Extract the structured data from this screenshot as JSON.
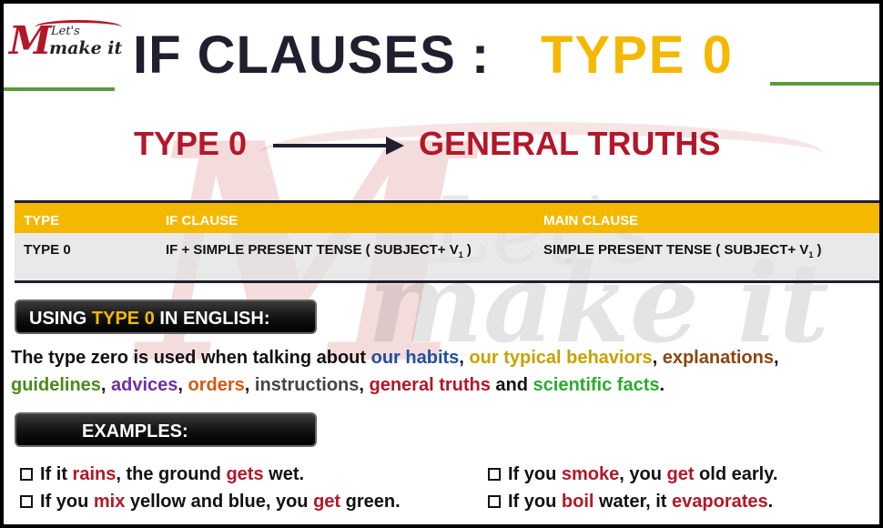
{
  "logo": {
    "m": "M",
    "lets": "Let's",
    "make": "make it"
  },
  "watermark": {
    "m": "M",
    "lets": "Let's",
    "make": "make it"
  },
  "header": {
    "title": "IF CLAUSES :",
    "type": "TYPE  0"
  },
  "subheading": {
    "left": "TYPE 0",
    "right": "GENERAL TRUTHS"
  },
  "table": {
    "columns": [
      "TYPE",
      "IF CLAUSE",
      "MAIN CLAUSE"
    ],
    "row": {
      "type": "TYPE 0",
      "if_clause": "IF + SIMPLE PRESENT TENSE ( SUBJECT+ V",
      "if_clause_sub": "1",
      "if_clause_end": " )",
      "main_clause": "SIMPLE PRESENT TENSE ( SUBJECT+ V",
      "main_clause_sub": "1",
      "main_clause_end": " )"
    }
  },
  "using_section": {
    "prefix": "USING ",
    "highlight": "TYPE 0",
    "suffix": "  IN ENGLISH:"
  },
  "paragraph": {
    "p1": "The type zero is used when talking about ",
    "k1": "our habits",
    "s1": ", ",
    "k2": "our typical behaviors",
    "s2": ", ",
    "k3": "explanations",
    "s3": ", ",
    "k4": "guidelines",
    "s4": ", ",
    "k5": "advices",
    "s5": ", ",
    "k6": "orders",
    "s6": ", ",
    "k7": "instructions",
    "s7": ", ",
    "k8": "general truths",
    "s8": " and ",
    "k9": "scientific facts",
    "s9": "."
  },
  "examples_section": {
    "label": "EXAMPLES:"
  },
  "examples": [
    {
      "a": "If it ",
      "b": "rains",
      "c": ", the ground ",
      "d": "gets",
      "e": " wet."
    },
    {
      "a": "If you ",
      "b": "mix",
      "c": " yellow and blue, you ",
      "d": "get",
      "e": " green."
    },
    {
      "a": "If you ",
      "b": "smoke",
      "c": ", you ",
      "d": "get",
      "e": " old early."
    },
    {
      "a": "If you ",
      "b": "boil",
      "c": " water, it ",
      "d": "evaporates",
      "e": "."
    }
  ],
  "colors": {
    "accent_yellow": "#f5b800",
    "accent_red": "#b3172a",
    "rule_green": "#5b9a3c",
    "dark": "#1f1f2e"
  }
}
